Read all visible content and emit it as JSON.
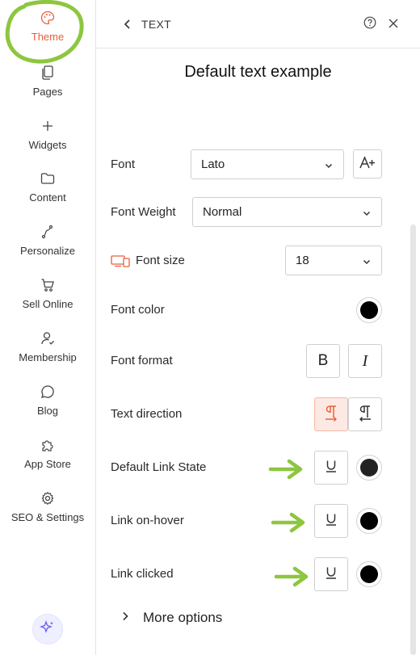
{
  "sidebar": {
    "items": [
      {
        "label": "Theme",
        "icon": "palette-icon"
      },
      {
        "label": "Pages",
        "icon": "pages-icon"
      },
      {
        "label": "Widgets",
        "icon": "plus-icon"
      },
      {
        "label": "Content",
        "icon": "folder-icon"
      },
      {
        "label": "Personalize",
        "icon": "personalize-icon"
      },
      {
        "label": "Sell Online",
        "icon": "cart-icon"
      },
      {
        "label": "Membership",
        "icon": "membership-icon"
      },
      {
        "label": "Blog",
        "icon": "chat-bubble-icon"
      },
      {
        "label": "App Store",
        "icon": "puzzle-icon"
      },
      {
        "label": "SEO & Settings",
        "icon": "gear-icon"
      }
    ],
    "active": "Theme",
    "active_color": "#e8603c",
    "annotation_color": "#8dc63f"
  },
  "panel": {
    "header_title": "TEXT",
    "preview_text": "Default text example",
    "font": {
      "label": "Font",
      "value": "Lato"
    },
    "font_weight": {
      "label": "Font Weight",
      "value": "Normal"
    },
    "font_size": {
      "label": "Font size",
      "value": "18"
    },
    "font_color": {
      "label": "Font color",
      "color": "#000000"
    },
    "font_format": {
      "label": "Font format",
      "bold": "B",
      "italic": "I"
    },
    "text_direction": {
      "label": "Text direction",
      "selected": "ltr"
    },
    "default_link_state": {
      "label": "Default Link State",
      "underline": "U",
      "color": "#222222"
    },
    "link_on_hover": {
      "label": "Link on-hover",
      "underline": "U",
      "color": "#000000"
    },
    "link_clicked": {
      "label": "Link clicked",
      "underline": "U",
      "color": "#000000"
    },
    "more_options": "More options"
  }
}
